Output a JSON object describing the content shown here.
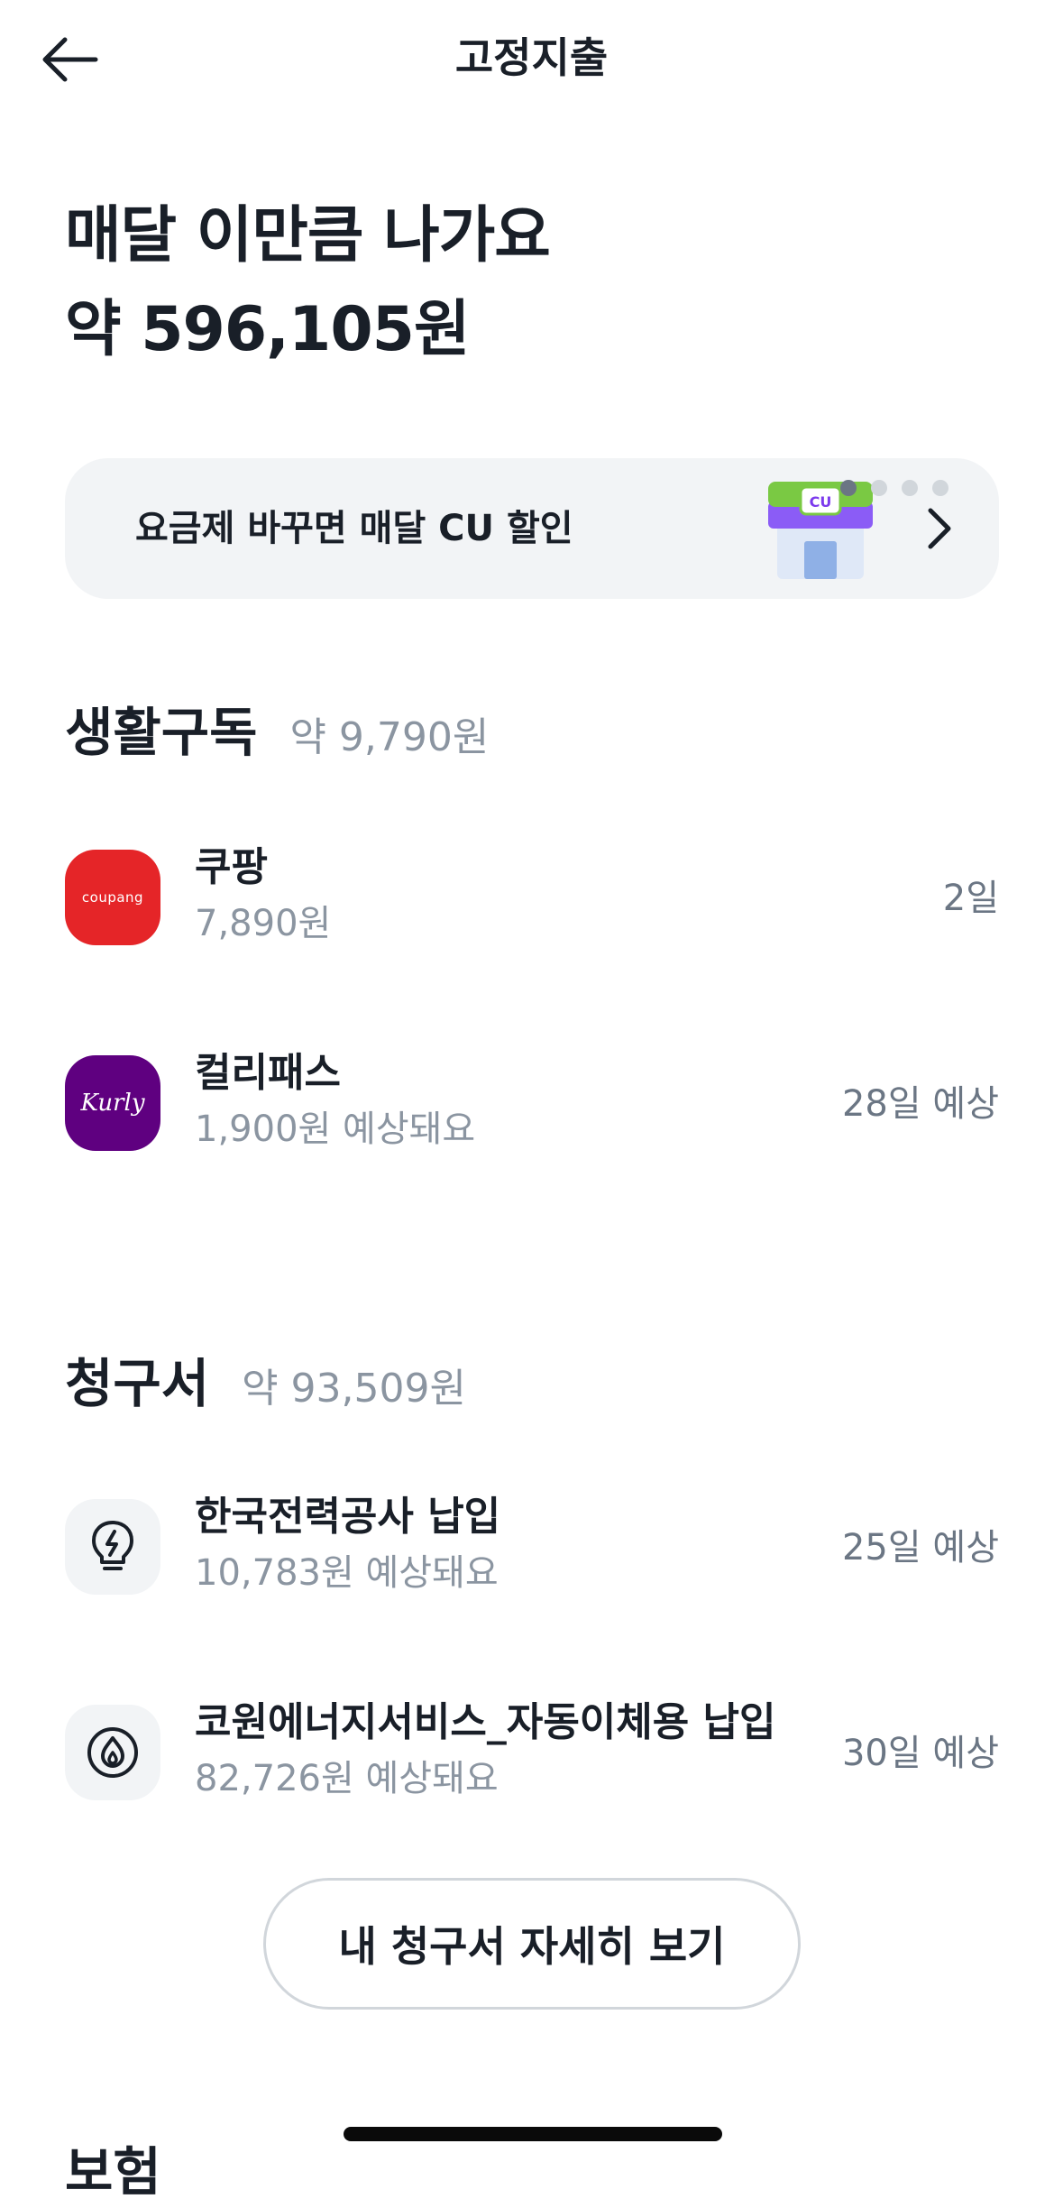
{
  "header": {
    "title": "고정지출",
    "back_icon": "arrow-left-icon"
  },
  "hero": {
    "line1": "매달 이만큼 나가요",
    "line2": "약 596,105원"
  },
  "banner": {
    "text": "요금제 바꾸면 매달 CU 할인",
    "image": "cu-store-icon",
    "image_label": "CU",
    "pager": {
      "total": 4,
      "active_index": 0
    },
    "chevron_icon": "chevron-right-icon"
  },
  "subscriptions": {
    "title": "생활구독",
    "amount": "약 9,790원",
    "items": [
      {
        "name": "쿠팡",
        "amount": "7,890원",
        "date": "2일",
        "icon": "coupang-logo",
        "icon_text": "coupang",
        "icon_color": "#e52528"
      },
      {
        "name": "컬리패스",
        "amount": "1,900원 예상돼요",
        "date": "28일 예상",
        "icon": "kurly-logo",
        "icon_text": "Kurly",
        "icon_color": "#5f0080"
      }
    ]
  },
  "bills": {
    "title": "청구서",
    "amount": "약 93,509원",
    "items": [
      {
        "name": "한국전력공사 납입",
        "amount": "10,783원 예상돼요",
        "date": "25일 예상",
        "icon": "lightbulb-icon"
      },
      {
        "name": "코원에너지서비스_자동이체용 납입",
        "amount": "82,726원 예상돼요",
        "date": "30일 예상",
        "icon": "flame-icon"
      }
    ],
    "detail_button": "내 청구서 자세히 보기"
  },
  "next_section_partial": "보험",
  "colors": {
    "text_primary": "#191f28",
    "text_secondary": "#8b95a1",
    "banner_bg": "#f2f4f6",
    "icon_bg": "#f2f4f6"
  }
}
